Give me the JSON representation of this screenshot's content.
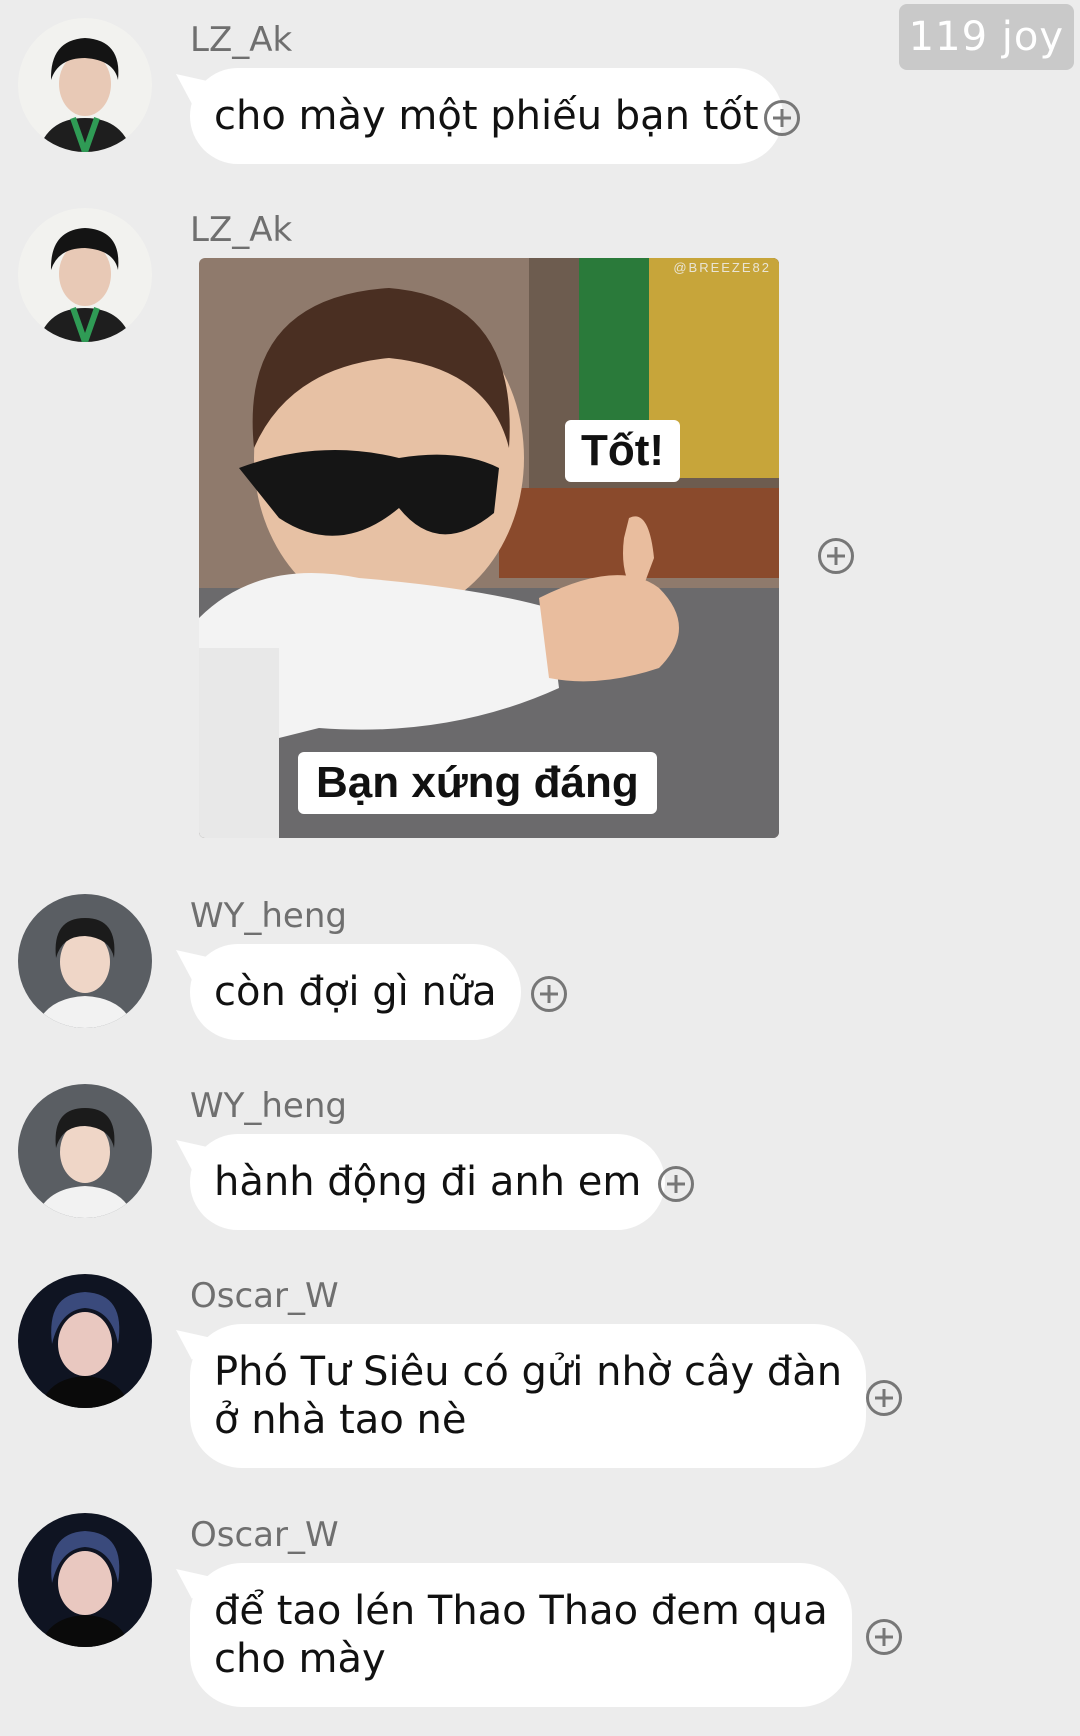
{
  "header": {
    "badge_text": "119 joy"
  },
  "messages": [
    {
      "sender": "LZ_Ak",
      "text": "cho mày một phiếu bạn tốt",
      "avatar": "avatar-lz-ak"
    },
    {
      "sender": "LZ_Ak",
      "sticker": {
        "top_caption": "Tốt!",
        "bottom_caption": "Bạn xứng đáng",
        "watermark": "@BREEZE82"
      },
      "avatar": "avatar-lz-ak"
    },
    {
      "sender": "WY_heng",
      "text": "còn đợi gì nữa",
      "avatar": "avatar-wy-heng"
    },
    {
      "sender": "WY_heng",
      "text": "hành động đi anh em",
      "avatar": "avatar-wy-heng"
    },
    {
      "sender": "Oscar_W",
      "text": "Phó Tư Siêu có gửi nhờ cây đàn\nở nhà tao nè",
      "avatar": "avatar-oscar-w"
    },
    {
      "sender": "Oscar_W",
      "text": "để tao lén Thao Thao đem qua\ncho mày",
      "avatar": "avatar-oscar-w"
    }
  ],
  "icons": {
    "react": "plus-circle-icon"
  },
  "colors": {
    "background": "#ececec",
    "bubble": "#ffffff",
    "name": "#6f6f6f",
    "badge": "#c9c9c9"
  }
}
